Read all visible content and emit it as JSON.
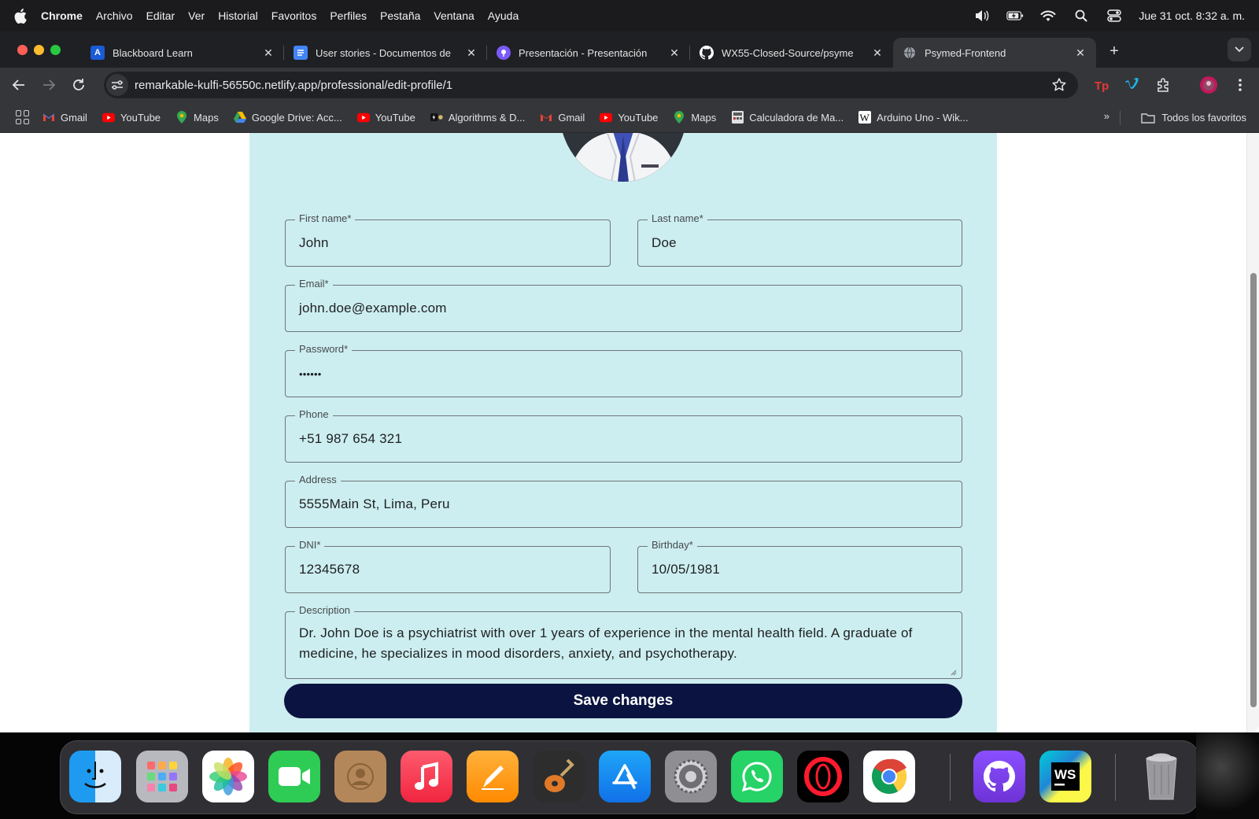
{
  "menubar": {
    "app": "Chrome",
    "items": [
      "Archivo",
      "Editar",
      "Ver",
      "Historial",
      "Favoritos",
      "Perfiles",
      "Pestaña",
      "Ventana",
      "Ayuda"
    ],
    "clock": "Jue 31 oct. 8:32 a. m."
  },
  "tabs": [
    {
      "title": "Blackboard Learn",
      "icon": "blackboard-icon",
      "color": "#1a5bd6"
    },
    {
      "title": "User stories - Documentos de",
      "icon": "docs-icon",
      "color": "#4285f4"
    },
    {
      "title": "Presentación - Presentación",
      "icon": "presentation-icon",
      "color": "#7a5af8"
    },
    {
      "title": "WX55-Closed-Source/psyme",
      "icon": "github-icon",
      "color": "#ffffff"
    },
    {
      "title": "Psymed-Frontend",
      "icon": "globe-icon",
      "color": "#9aa0a6"
    }
  ],
  "address": {
    "host": "remarkable-kulfi-56550c.netlify.app",
    "path": "/professional/edit-profile/1"
  },
  "bookmarks": [
    {
      "label": "Gmail",
      "icon": "gmail-icon"
    },
    {
      "label": "YouTube",
      "icon": "youtube-icon"
    },
    {
      "label": "Maps",
      "icon": "maps-icon"
    },
    {
      "label": "Google Drive: Acc...",
      "icon": "drive-icon"
    },
    {
      "label": "YouTube",
      "icon": "youtube-icon"
    },
    {
      "label": "Algorithms & D...",
      "icon": "algorithms-icon"
    },
    {
      "label": "Gmail",
      "icon": "gmail-icon"
    },
    {
      "label": "YouTube",
      "icon": "youtube-icon"
    },
    {
      "label": "Maps",
      "icon": "maps-icon"
    },
    {
      "label": "Calculadora de Ma...",
      "icon": "calculator-icon"
    },
    {
      "label": "Arduino Uno - Wik...",
      "icon": "wikipedia-icon"
    }
  ],
  "bookmarks_all": "Todos los favoritos",
  "form": {
    "first_name": {
      "label": "First name*",
      "value": "John"
    },
    "last_name": {
      "label": "Last name*",
      "value": "Doe"
    },
    "email": {
      "label": "Email*",
      "value": "john.doe@example.com"
    },
    "password": {
      "label": "Password*",
      "value": "••••••"
    },
    "phone": {
      "label": "Phone",
      "value": "+51 987 654 321"
    },
    "address": {
      "label": "Address",
      "value": "5555Main St, Lima, Peru"
    },
    "dni": {
      "label": "DNI*",
      "value": "12345678"
    },
    "birthday": {
      "label": "Birthday*",
      "value": "10/05/1981"
    },
    "description": {
      "label": "Description",
      "value": "Dr. John Doe is a psychiatrist with over 1 years of experience in the mental health field. A graduate of medicine, he specializes in mood disorders, anxiety, and psychotherapy."
    },
    "save_label": "Save changes"
  },
  "dock": [
    "finder-icon",
    "launchpad-icon",
    "photos-icon",
    "facetime-icon",
    "contacts-icon",
    "music-icon",
    "pages-icon",
    "garageband-icon",
    "app-store-icon",
    "system-settings-icon",
    "whatsapp-icon",
    "opera-icon",
    "chrome-icon",
    "github-desktop-icon",
    "webstorm-icon",
    "trash-icon"
  ],
  "colors": {
    "card_bg": "#cdeef0",
    "button_bg": "#0b1440",
    "field_border": "#6e7479"
  }
}
